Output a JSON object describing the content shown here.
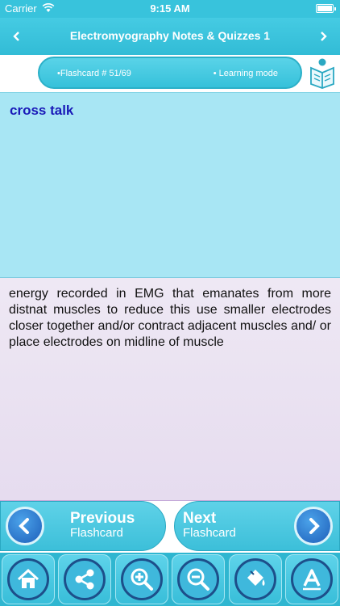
{
  "status_bar": {
    "carrier": "Carrier",
    "time": "9:15 AM"
  },
  "nav": {
    "title": "Electromyography Notes & Quizzes 1",
    "back_icon": "chevron-left-icon",
    "forward_icon": "chevron-right-icon"
  },
  "info": {
    "flashcard": "•Flashcard #  51/69",
    "mode": "• Learning mode",
    "logo_icon": "book-reader-logo"
  },
  "card": {
    "term": "cross talk",
    "definition": "energy recorded in EMG that emanates from more distnat muscles  to reduce this use smaller electrodes closer together and/or contract adjacent muscles and/ or place electrodes on midline of muscle"
  },
  "pager": {
    "prev_label": "Previous",
    "prev_sub": "Flashcard",
    "next_label": "Next",
    "next_sub": "Flashcard"
  },
  "toolbar": {
    "items": [
      "home-icon",
      "share-icon",
      "zoom-in-icon",
      "zoom-out-icon",
      "paint-bucket-icon",
      "font-icon"
    ]
  },
  "colors": {
    "accent": "#38c3dc",
    "question_bg": "#a8e6f4",
    "answer_bg": "#eee8f4",
    "term_text": "#1a1ab8"
  }
}
